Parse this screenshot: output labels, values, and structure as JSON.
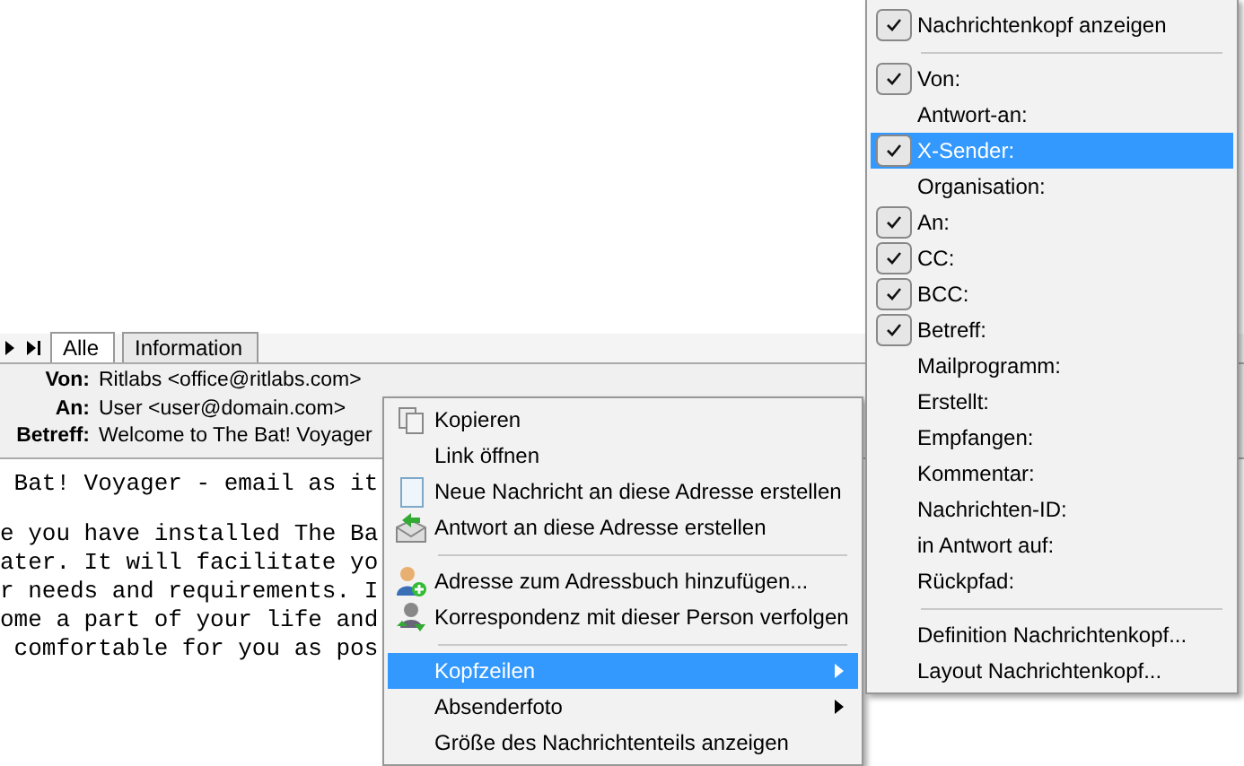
{
  "tabs": [
    {
      "label": "Alle",
      "selected": true
    },
    {
      "label": "Information",
      "selected": false
    }
  ],
  "header": [
    {
      "label": "Von:",
      "value": "Ritlabs <office@ritlabs.com>"
    },
    {
      "label": "An:",
      "value": "User <user@domain.com>"
    },
    {
      "label": "Betreff:",
      "value": "Welcome to The Bat! Voyager"
    }
  ],
  "body_lines": [
    " Bat! Voyager - email as it",
    "e you have installed The Ba",
    "ater. It will facilitate yo",
    "r needs and requirements. I",
    "ome a part of your life and",
    " comfortable for you as pos"
  ],
  "context_menu": [
    {
      "kind": "item",
      "label": "Kopieren",
      "selected": false
    },
    {
      "kind": "item",
      "label": "Link öffnen",
      "selected": false
    },
    {
      "kind": "item",
      "label": "Neue Nachricht an diese Adresse erstellen",
      "selected": false
    },
    {
      "kind": "item",
      "label": "Antwort an diese Adresse erstellen",
      "selected": false
    },
    {
      "kind": "separator"
    },
    {
      "kind": "item",
      "label": "Adresse zum Adressbuch hinzufügen...",
      "selected": false
    },
    {
      "kind": "item",
      "label": "Korrespondenz mit dieser Person verfolgen",
      "selected": false
    },
    {
      "kind": "separator"
    },
    {
      "kind": "submenu",
      "label": "Kopfzeilen",
      "selected": true
    },
    {
      "kind": "submenu",
      "label": "Absenderfoto",
      "selected": false
    },
    {
      "kind": "item",
      "label": "Größe des Nachrichtenteils anzeigen",
      "selected": false
    }
  ],
  "submenu": [
    {
      "kind": "item",
      "label": "Nachrichtenkopf anzeigen",
      "checked": true,
      "selected": false
    },
    {
      "kind": "separator"
    },
    {
      "kind": "item",
      "label": "Von:",
      "checked": true,
      "selected": false
    },
    {
      "kind": "item",
      "label": "Antwort-an:",
      "checked": false,
      "selected": false
    },
    {
      "kind": "item",
      "label": "X-Sender:",
      "checked": true,
      "selected": true
    },
    {
      "kind": "item",
      "label": "Organisation:",
      "checked": false,
      "selected": false
    },
    {
      "kind": "item",
      "label": "An:",
      "checked": true,
      "selected": false
    },
    {
      "kind": "item",
      "label": "CC:",
      "checked": true,
      "selected": false
    },
    {
      "kind": "item",
      "label": "BCC:",
      "checked": true,
      "selected": false
    },
    {
      "kind": "item",
      "label": "Betreff:",
      "checked": true,
      "selected": false
    },
    {
      "kind": "item",
      "label": "Mailprogramm:",
      "checked": false,
      "selected": false
    },
    {
      "kind": "item",
      "label": "Erstellt:",
      "checked": false,
      "selected": false
    },
    {
      "kind": "item",
      "label": "Empfangen:",
      "checked": false,
      "selected": false
    },
    {
      "kind": "item",
      "label": "Kommentar:",
      "checked": false,
      "selected": false
    },
    {
      "kind": "item",
      "label": "Nachrichten-ID:",
      "checked": false,
      "selected": false
    },
    {
      "kind": "item",
      "label": "in Antwort auf:",
      "checked": false,
      "selected": false
    },
    {
      "kind": "item",
      "label": "Rückpfad:",
      "checked": false,
      "selected": false
    },
    {
      "kind": "separator"
    },
    {
      "kind": "item",
      "label": "Definition Nachrichtenkopf...",
      "checked": false,
      "selected": false
    },
    {
      "kind": "item",
      "label": "Layout Nachrichtenkopf...",
      "checked": false,
      "selected": false
    }
  ]
}
